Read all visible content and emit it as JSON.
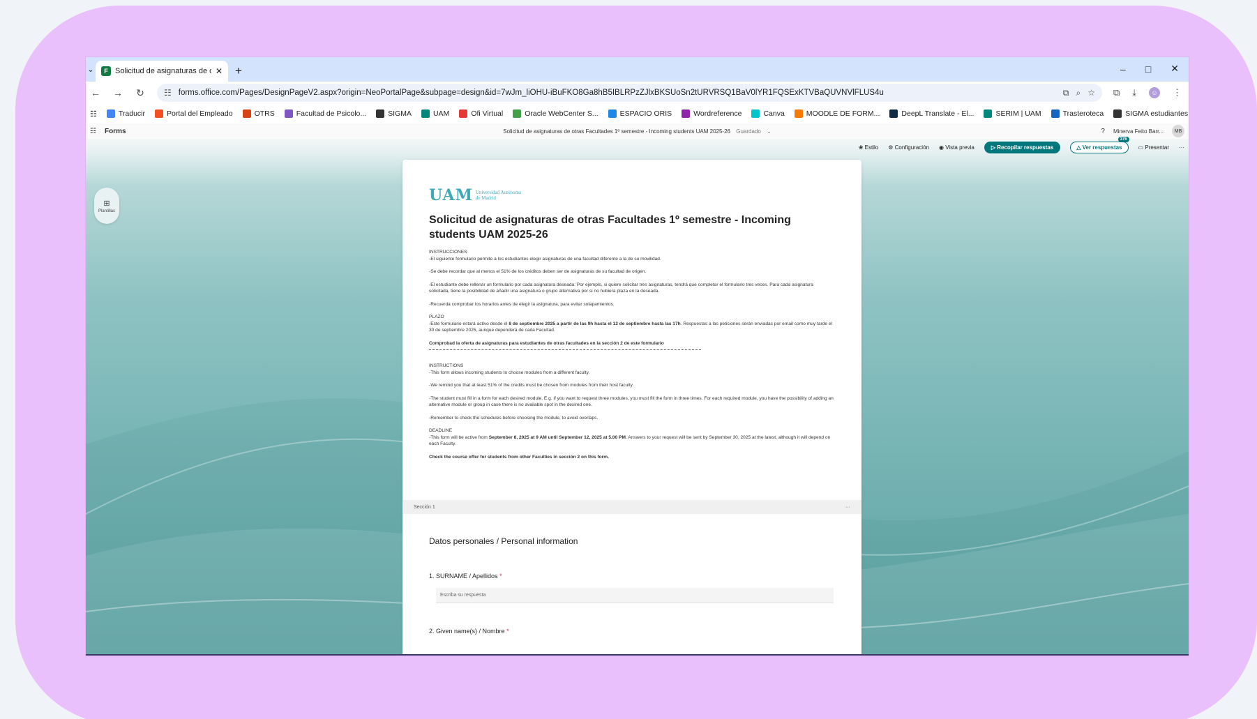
{
  "browser": {
    "tab_title": "Solicitud de asignaturas de otr",
    "new_tab": "+",
    "url": "forms.office.com/Pages/DesignPageV2.aspx?origin=NeoPortalPage&subpage=design&id=7wJm_liOHU-iBuFKO8Ga8hB5IBLRPzZJlxBKSUoSn2tURVRSQ1BaV0lYR1FQSExKTVBaQUVNVlFLUS4u",
    "window_controls": [
      "–",
      "□",
      "✕"
    ]
  },
  "bookmarks": [
    {
      "label": "Traducir",
      "color": "#4285f4"
    },
    {
      "label": "Portal del Empleado",
      "color": "#f25022"
    },
    {
      "label": "OTRS",
      "color": "#d84315"
    },
    {
      "label": "Facultad de Psicolo...",
      "color": "#7e57c2"
    },
    {
      "label": "SIGMA",
      "color": "#333333"
    },
    {
      "label": "UAM",
      "color": "#00897b"
    },
    {
      "label": "Ofi Virtual",
      "color": "#e53935"
    },
    {
      "label": "Oracle WebCenter S...",
      "color": "#43a047"
    },
    {
      "label": "ESPACIO ORIS",
      "color": "#1e88e5"
    },
    {
      "label": "Wordreference",
      "color": "#8e24aa"
    },
    {
      "label": "Canva",
      "color": "#00c4cc"
    },
    {
      "label": "MOODLE DE FORM...",
      "color": "#f57c00"
    },
    {
      "label": "DeepL Translate - El...",
      "color": "#0f2b46"
    },
    {
      "label": "SERIM | UAM",
      "color": "#00897b"
    },
    {
      "label": "Trasteroteca",
      "color": "#1565c0"
    },
    {
      "label": "SIGMA estudiantes",
      "color": "#333333"
    }
  ],
  "app": {
    "name": "Forms",
    "doc_title": "Solicitud de asignaturas de otras Facultades 1º semestre - Incoming students UAM 2025-26",
    "saved": "Guardado",
    "help": "?",
    "user_name": "Minerva Feito Barr...",
    "user_initials": "MB",
    "cmd_style": "Estilo",
    "cmd_config": "Configuración",
    "cmd_preview": "Vista previa",
    "cmd_collect": "Recopilar respuestas",
    "cmd_responses": "Ver respuestas",
    "responses_badge": "376",
    "cmd_present": "Presentar",
    "cmd_more": "···",
    "side_label": "Plantillas"
  },
  "form": {
    "logo_mark": "UAM",
    "logo_line1": "Universidad Autónoma",
    "logo_line2": "de Madrid",
    "title": "Solicitud de asignaturas de otras Facultades 1º semestre - Incoming students UAM 2025-26",
    "es_h": "INSTRUCCIONES",
    "es_1": "-El siguiente formulario permite a los estudiantes elegir asignaturas de una facultad diferente a la de su movilidad.",
    "es_2": "-Se debe recordar que al menos el 51% de los créditos deben ser de asignaturas de su facultad de origen.",
    "es_3": "-El estudiante debe rellenar un formulario por cada asignatura deseada: Por ejemplo, si quiere solicitar tres asignaturas, tendrá que completar el formulario tres veces. Para cada asignatura solicitada, tiene la posibilidad de añadir una asignatura o grupo alternativa por si no hubiera plaza en la deseada.",
    "es_4": "-Recuerda comprobar los horarios antes de elegir la asignatura, para evitar solapamientos.",
    "plazo_h": "PLAZO",
    "plazo_a": "-Este formulario estará activo desde el ",
    "plazo_b": "8 de septiembre 2025 a partir de las 9h hasta el 12 de septiembre hasta las 17h",
    "plazo_c": ". Respuestas a las peticiones serán enviadas por email como muy tarde el 30 de septiembre 2025, aunque dependerá de cada Facultad.",
    "es_bold": "Comprobad la oferta de asignaturas para estudiantes de otras facultades en la sección 2 de este formulario",
    "en_h": "INSTRUCTIONS",
    "en_1": "-This form allows incoming students to choose modules from a different faculty.",
    "en_2": "-We remind you that at least 51% of the credits must be chosen from modules from their host faculty.",
    "en_3": "-The student must fill in a form for each desired module. E.g. if you want to request three modules, you must fill the form in three times. For each required module, you have the possibility of adding an alternative module or group in case there is no available spot in the desired one.",
    "en_4": "-Remember to check the schedules before choosing the module, to avoid overlaps.",
    "dl_h": "DEADLINE",
    "dl_a": "-This form will be active from ",
    "dl_b": "September 8, 2025 at 9 AM until September 12, 2025 at 5.00 PM",
    "dl_c": ". Answers to your request will be sent by September 30, 2025 at the latest, although it will depend on each Faculty.",
    "en_bold": "Check the course offer for students from other Faculties in sección 2 on this form.",
    "section_label": "Sección 1",
    "section_more": "···",
    "section_title": "Datos personales / Personal information",
    "q1": "1. SURNAME / Apellidos",
    "q1_placeholder": "Escriba su respuesta",
    "q2": "2. Given name(s) / Nombre",
    "required": "*"
  }
}
